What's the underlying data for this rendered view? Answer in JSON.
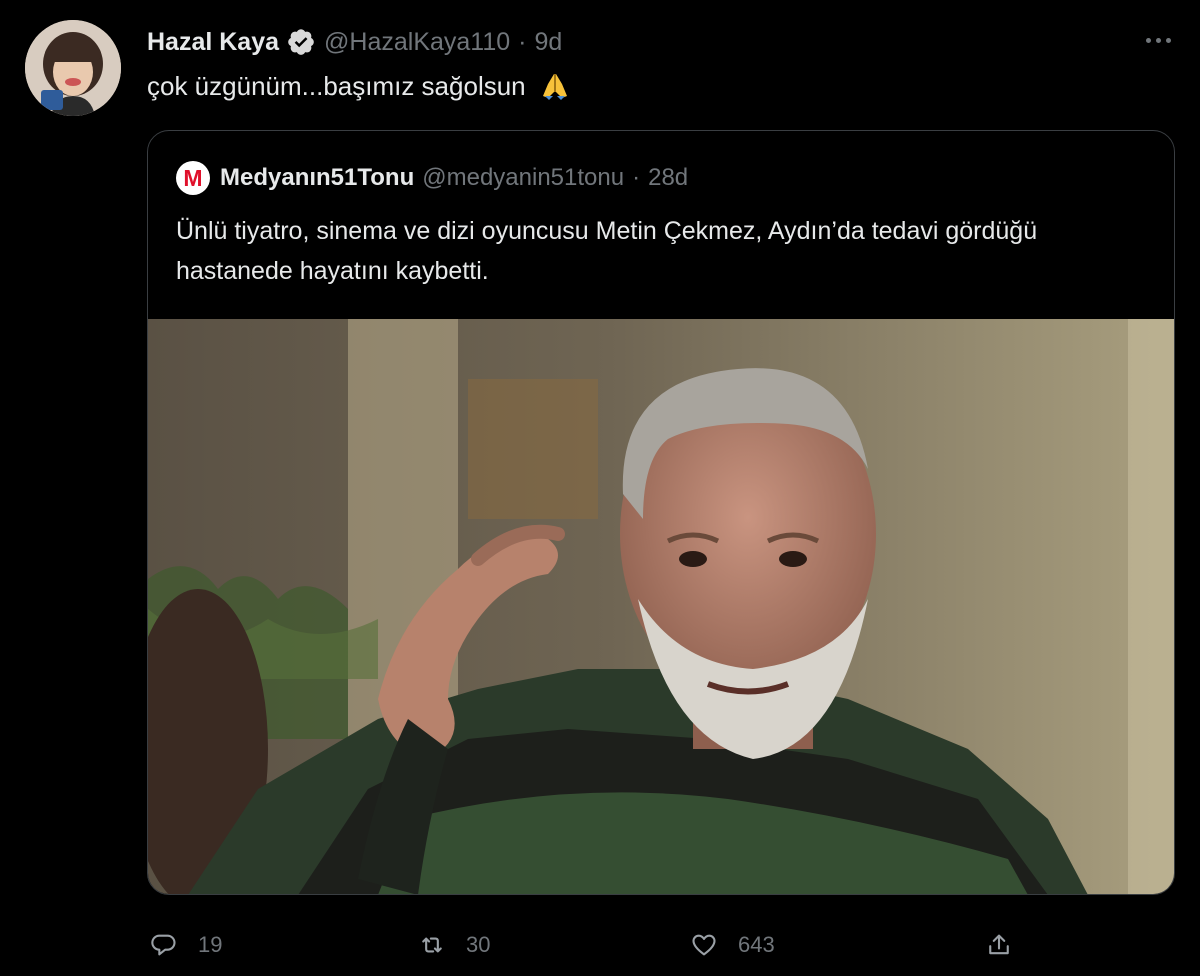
{
  "tweet": {
    "author_name": "Hazal Kaya",
    "handle": "@HazalKaya110",
    "separator": "·",
    "time": "9d",
    "text": "çok üzgünüm...başımız sağolsun",
    "emoji": "folded-hands-emoji"
  },
  "quote": {
    "logo_letter": "M",
    "author_name": "Medyanın51Tonu",
    "handle": "@medyanin51tonu",
    "separator": "·",
    "time": "28d",
    "text": "Ünlü tiyatro, sinema ve dizi oyuncusu Metin Çekmez, Aydın’da tedavi gördüğü hastanede hayatını kaybetti."
  },
  "actions": {
    "reply_count": "19",
    "retweet_count": "30",
    "like_count": "643"
  },
  "colors": {
    "background": "#000000",
    "text_primary": "#e7e9ea",
    "text_secondary": "#71767b",
    "border": "#3a3e42",
    "verified": "#d9d9d9",
    "brand_red": "#e0102b"
  }
}
